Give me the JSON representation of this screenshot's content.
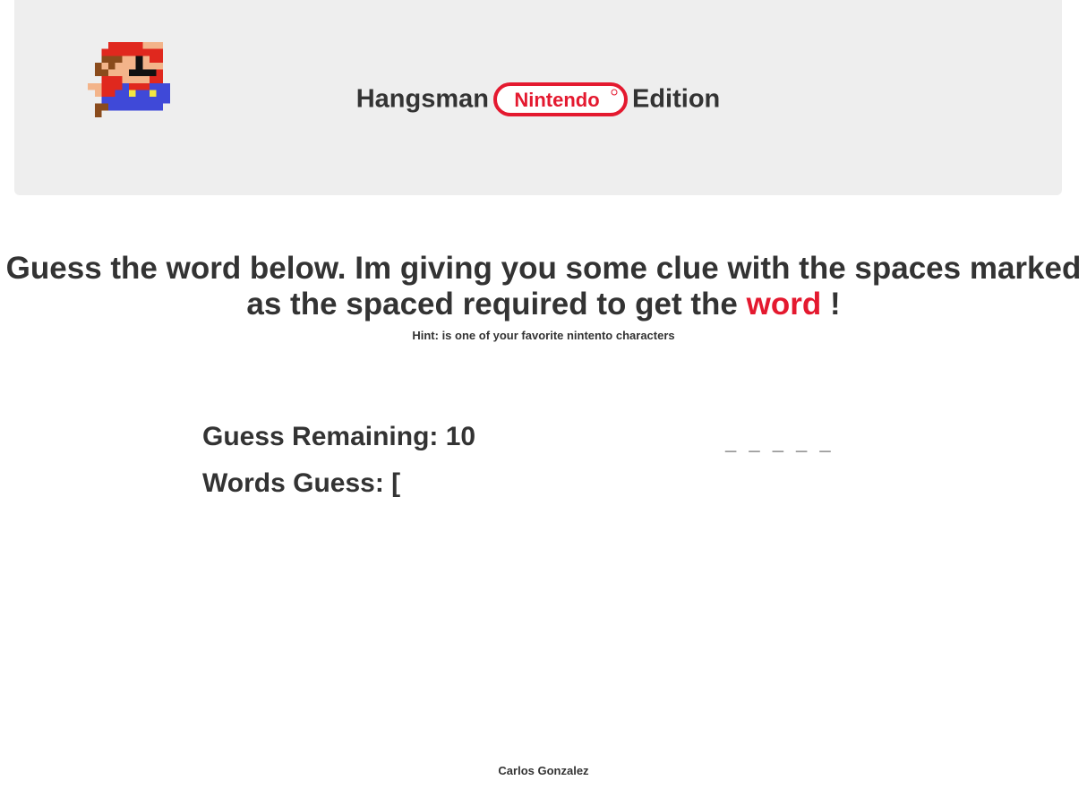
{
  "header": {
    "title_prefix": "Hangsman",
    "logo_text": "Nintendo",
    "title_suffix": "Edition",
    "mascot_icon": "mario-sprite-icon",
    "logo_color": "#e4192f"
  },
  "main": {
    "headline_part1": "Guess the word below. Im giving you some clue with the spaces marked as the spaced required to get the",
    "headline_highlight": "word",
    "headline_end": "!",
    "hint": "Hint: is one of your favorite nintento characters",
    "guesses_label": "Guess Remaining:",
    "guesses_value": "10",
    "words_label": "Words Guess:",
    "words_value": "[",
    "blanks": "_ _ _ _ _",
    "highlight_color": "#e4192f"
  },
  "footer": {
    "author": "Carlos Gonzalez"
  }
}
